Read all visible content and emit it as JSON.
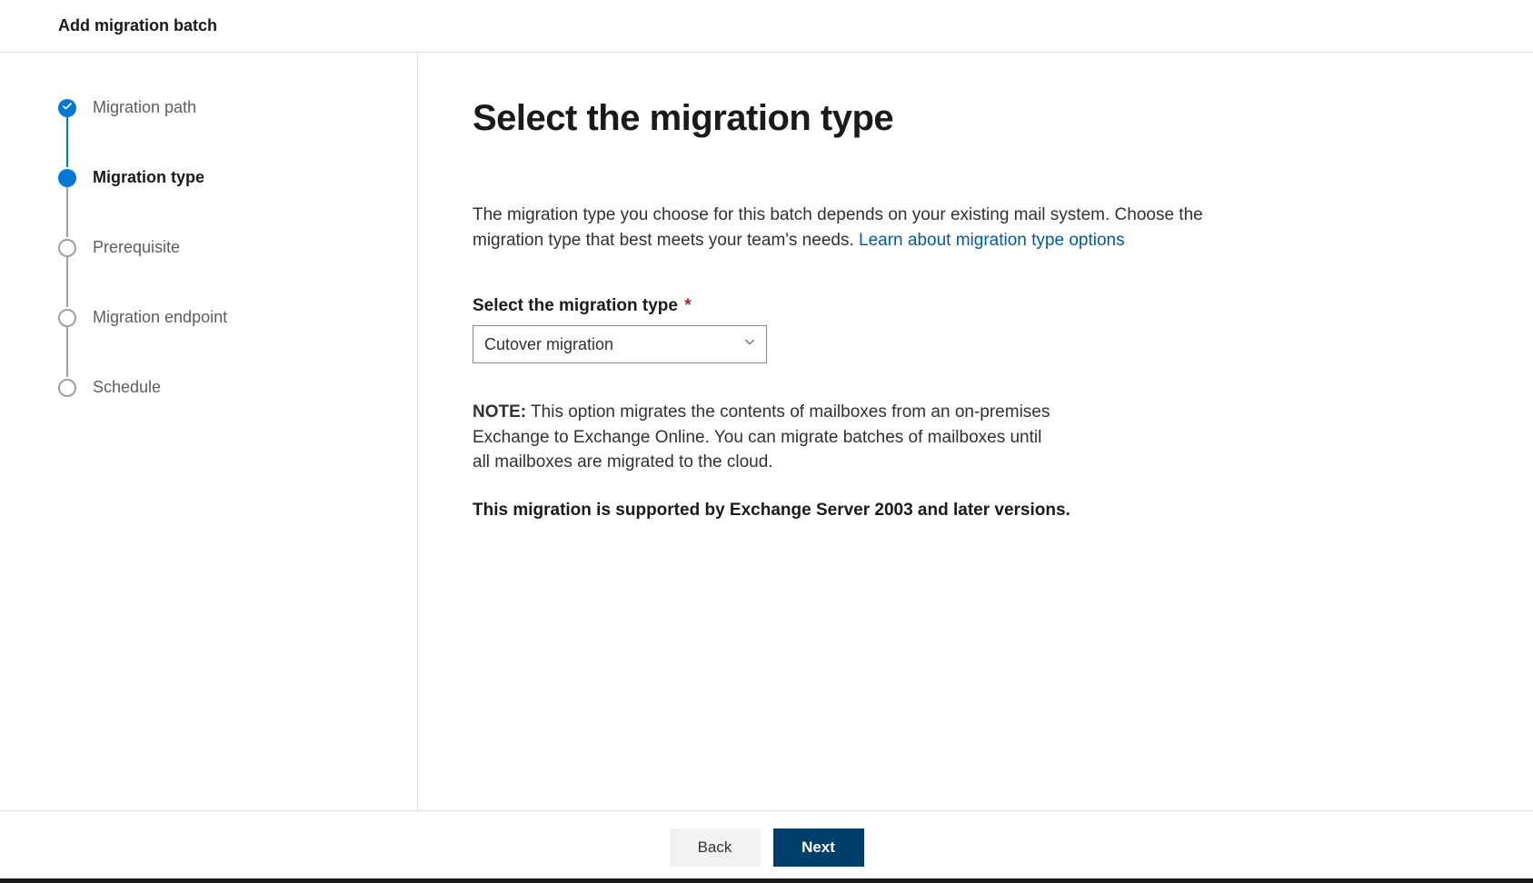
{
  "header": {
    "title": "Add migration batch"
  },
  "sidebar": {
    "steps": [
      {
        "label": "Migration path",
        "status": "completed"
      },
      {
        "label": "Migration type",
        "status": "current"
      },
      {
        "label": "Prerequisite",
        "status": "pending"
      },
      {
        "label": "Migration endpoint",
        "status": "pending"
      },
      {
        "label": "Schedule",
        "status": "pending"
      }
    ]
  },
  "main": {
    "title": "Select the migration type",
    "description_prefix": "The migration type you choose for this batch depends on your existing mail system. Choose the migration type that best meets your team's needs. ",
    "description_link": "Learn about migration type options",
    "field_label": "Select the migration type",
    "required_marker": "*",
    "select_value": "Cutover migration",
    "note_label": "NOTE:",
    "note_text": " This option migrates the contents of mailboxes from an on-premises Exchange to Exchange Online. You can migrate batches of mailboxes until all mailboxes are migrated to the cloud.",
    "support_text": "This migration is supported by Exchange Server 2003 and later versions."
  },
  "footer": {
    "back_label": "Back",
    "next_label": "Next"
  }
}
